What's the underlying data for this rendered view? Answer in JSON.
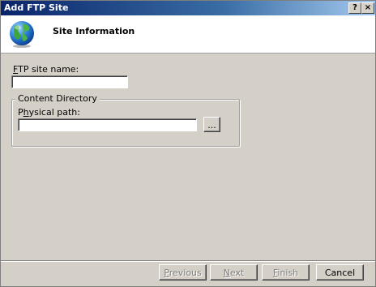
{
  "window": {
    "title": "Add FTP Site",
    "help_button": "?",
    "close_button": "×"
  },
  "header": {
    "title": "Site Information",
    "icon": "globe-icon"
  },
  "form": {
    "site_name_label": {
      "accel": "F",
      "rest": "TP site name:"
    },
    "site_name_value": "",
    "content_directory": {
      "legend": "Content Directory",
      "physical_path_label": {
        "pre": "P",
        "accel": "h",
        "rest": "ysical path:"
      },
      "physical_path_value": "",
      "browse_button": "..."
    }
  },
  "buttons": {
    "previous": {
      "accel": "P",
      "rest": "revious",
      "enabled": false
    },
    "next": {
      "accel": "N",
      "rest": "ext",
      "enabled": false
    },
    "finish": {
      "accel": "F",
      "rest": "inish",
      "enabled": false
    },
    "cancel": {
      "label": "Cancel",
      "enabled": true
    }
  },
  "colors": {
    "dialog_background": "#d4d0c8",
    "title_bar": "#0a246a",
    "header_background": "#ffffff"
  }
}
